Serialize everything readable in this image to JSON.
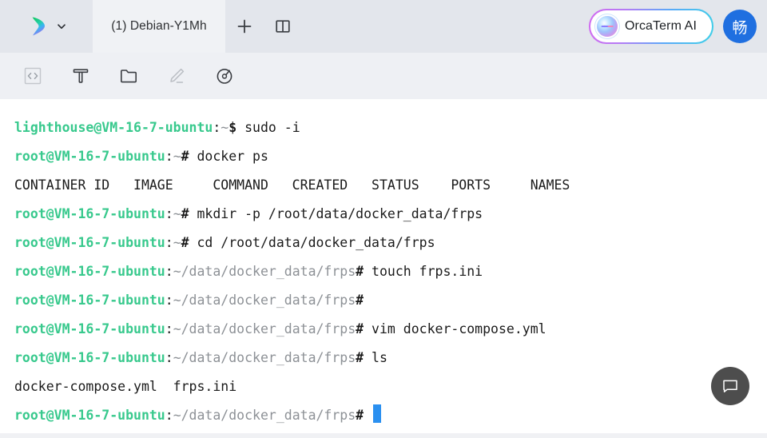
{
  "window": {
    "title_bar": {
      "brand_icon": "orcaterm-logo",
      "brand_caret_icon": "chevron-down-icon",
      "tabs": [
        {
          "label": "(1) Debian-Y1Mh",
          "active": true
        }
      ],
      "new_tab_icon": "plus-icon",
      "split_icon": "split-pane-icon",
      "ai_button": {
        "label": "OrcaTerm AI",
        "orb_icon": "ai-orb-icon"
      },
      "avatar": {
        "initial": "畅"
      }
    },
    "toolbar": {
      "items": [
        {
          "name": "code-icon",
          "title": "Code",
          "disabled": true
        },
        {
          "name": "text-icon",
          "title": "Text",
          "disabled": false
        },
        {
          "name": "folder-icon",
          "title": "Files",
          "disabled": false
        },
        {
          "name": "pencil-icon",
          "title": "Edit",
          "disabled": true
        },
        {
          "name": "dashboard-icon",
          "title": "Monitor",
          "disabled": false
        }
      ]
    },
    "fab": {
      "icon": "chat-bubble-icon",
      "title": "Chat"
    }
  },
  "colors": {
    "prompt_green": "#38c98d",
    "path_gray": "#8d9196",
    "cursor_blue": "#2b90f0",
    "avatar_blue": "#1f6fe0",
    "header_bg": "#e3e6ec",
    "tab_bg": "#f0f2f5",
    "toolbar_bg": "#eef0f4",
    "terminal_bg": "#ffffff",
    "terminal_fg": "#1a1a1a",
    "fab_bg": "#4d4d4d"
  },
  "terminal": {
    "lines": [
      {
        "type": "prompt",
        "user": "lighthouse@VM-16-7-ubuntu",
        "colon": ":",
        "path": "~",
        "sym": "$",
        "cmd": " sudo -i"
      },
      {
        "type": "prompt",
        "user": "root@VM-16-7-ubuntu",
        "colon": ":",
        "path": "~",
        "sym": "#",
        "cmd": " docker ps"
      },
      {
        "type": "output",
        "text": "CONTAINER ID   IMAGE     COMMAND   CREATED   STATUS    PORTS     NAMES"
      },
      {
        "type": "prompt",
        "user": "root@VM-16-7-ubuntu",
        "colon": ":",
        "path": "~",
        "sym": "#",
        "cmd": " mkdir -p /root/data/docker_data/frps"
      },
      {
        "type": "prompt",
        "user": "root@VM-16-7-ubuntu",
        "colon": ":",
        "path": "~",
        "sym": "#",
        "cmd": " cd /root/data/docker_data/frps"
      },
      {
        "type": "prompt",
        "user": "root@VM-16-7-ubuntu",
        "colon": ":",
        "path": "~/data/docker_data/frps",
        "sym": "#",
        "cmd": " touch frps.ini"
      },
      {
        "type": "prompt",
        "user": "root@VM-16-7-ubuntu",
        "colon": ":",
        "path": "~/data/docker_data/frps",
        "sym": "#",
        "cmd": ""
      },
      {
        "type": "prompt",
        "user": "root@VM-16-7-ubuntu",
        "colon": ":",
        "path": "~/data/docker_data/frps",
        "sym": "#",
        "cmd": " vim docker-compose.yml"
      },
      {
        "type": "prompt",
        "user": "root@VM-16-7-ubuntu",
        "colon": ":",
        "path": "~/data/docker_data/frps",
        "sym": "#",
        "cmd": " ls"
      },
      {
        "type": "output",
        "text": "docker-compose.yml  frps.ini"
      },
      {
        "type": "prompt",
        "user": "root@VM-16-7-ubuntu",
        "colon": ":",
        "path": "~/data/docker_data/frps",
        "sym": "#",
        "cmd": " ",
        "cursor": true
      }
    ]
  }
}
